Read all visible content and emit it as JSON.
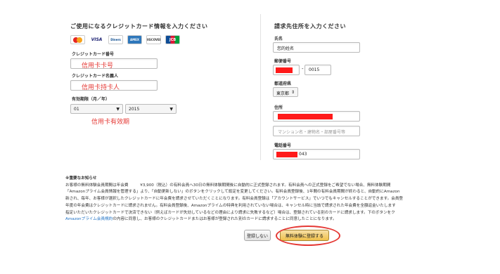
{
  "card_section": {
    "title": "ご使用になるクレジットカード情報を入力ください",
    "logos": [
      "mastercard-icon",
      "visa-icon",
      "diners-icon",
      "amex-icon",
      "discover-icon",
      "jcb-icon"
    ],
    "logo_texts": {
      "visa": "VISA",
      "diners": "Diners",
      "amex": "AMEX",
      "discover": "DISCOVER",
      "jcb": "JCB"
    },
    "card_number_label": "クレジットカード番号",
    "card_number_hint": "信用卡卡号",
    "card_holder_label": "クレジットカード名義人",
    "card_holder_hint": "信用卡持卡人",
    "expiry_label": "有効期限（月／年）",
    "expiry_month": "01",
    "expiry_year": "2015",
    "expiry_hint": "信用卡有效期"
  },
  "address_section": {
    "title": "請求先住所を入力ください",
    "name_label": "氏名",
    "name_value": "您的姓名",
    "postal_label": "郵便番号",
    "postal_dash": "-",
    "postal_value2": "0015",
    "prefecture_label": "都道府県",
    "prefecture_value": "東京都",
    "address_label": "住所",
    "address_line2_placeholder": "マンション名・建物名・部屋番号等",
    "phone_label": "電話番号",
    "phone_suffix": "043"
  },
  "notice": {
    "heading": "※重要なお知らせ",
    "lines": [
      "お客様の無料体験会員期間は年会費　　　¥3,900（税込）の有料会員へ30日の無料体験期間後に自動的に正式登録されます。有料会員への正式登録をご希望でない場合、無料体験期間",
      "「Amazonプライム会員情報を管理する」より、「自動更新しない」のボタンをクリックして設定を変更してください。有料会員登録後、1年間の有料会員期間が終わると、自動的にAmazon",
      "新され、毎年、お客様が選択したクレジットカードに年会費を請求させていただくことになります。有料会員登録は「アカウントサービス」でいつでもキャンセルすることができます。会員登",
      "年度の年会費はクレジットカードに請求されません。有料会員登録後、Amazonプライムの特典を利用されていない場合は、キャンセル時に当該で請求された年会費を全額返金いたします",
      "指定いただいたクレジットカードで決済できない（例えばカードが失効しているなどの理由により請求に失敗するなど）場合は、登録されている別のカードに請求します。下のボタンをク"
    ],
    "last_line_link": "Amazonプライム会員規約",
    "last_line_rest": "の内容に同意し、お客様のクレジットカードまたはお客様が登録された別のカードに請求することに同意したことになります。"
  },
  "buttons": {
    "cancel": "登録しない",
    "confirm": "無料体験に登録する"
  },
  "colors": {
    "hint_red": "#e53935",
    "link_blue": "#1a6fc4",
    "confirm_button": "#f0c14b",
    "redaction": "#ff1a1a"
  }
}
